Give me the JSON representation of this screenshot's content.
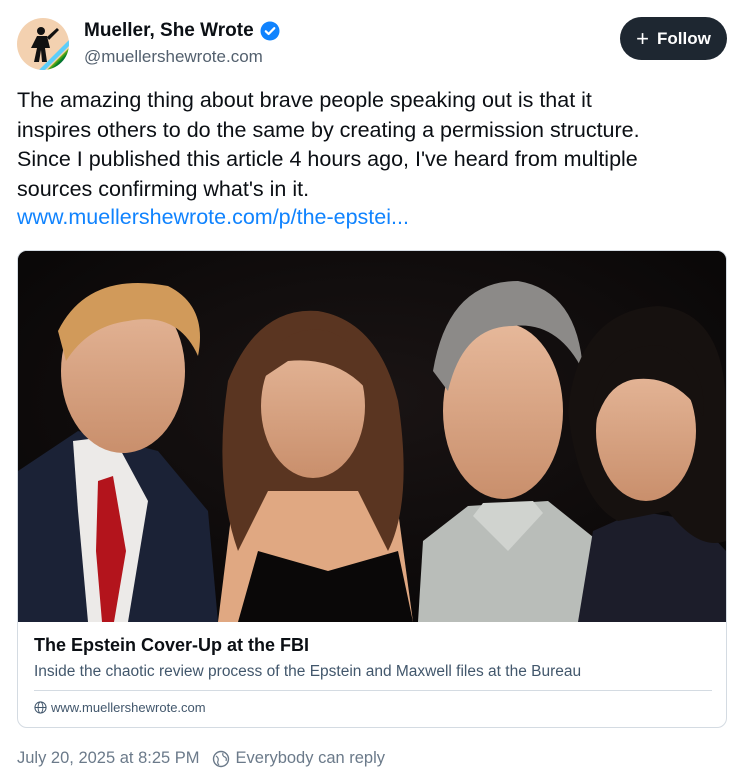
{
  "author": {
    "name": "Mueller, She Wrote",
    "handle": "@muellershewrote.com",
    "verified": true,
    "avatar_icon": "avatar-silhouette-rainbow"
  },
  "follow_button": {
    "icon": "plus-icon",
    "label": "Follow"
  },
  "post": {
    "text_lines": [
      "The amazing thing about brave people speaking out is that it",
      "inspires others to do the same by creating a permission structure.",
      "Since I published this article 4 hours ago, I've heard from multiple",
      "sources confirming what's in it."
    ],
    "link": "www.muellershewrote.com/p/the-epstei..."
  },
  "link_card": {
    "title": "The Epstein Cover-Up at the FBI",
    "description": "Inside the chaotic review process of the Epstein and Maxwell files at the Bureau",
    "domain_icon": "globe-icon",
    "domain": "www.muellershewrote.com"
  },
  "meta": {
    "timestamp": "July 20, 2025 at 8:25 PM",
    "reply_icon": "globe-reply-icon",
    "reply_setting": "Everybody can reply"
  },
  "colors": {
    "link": "#1083fe",
    "follow_bg": "#1e2731",
    "muted": "#6b7a8a"
  }
}
